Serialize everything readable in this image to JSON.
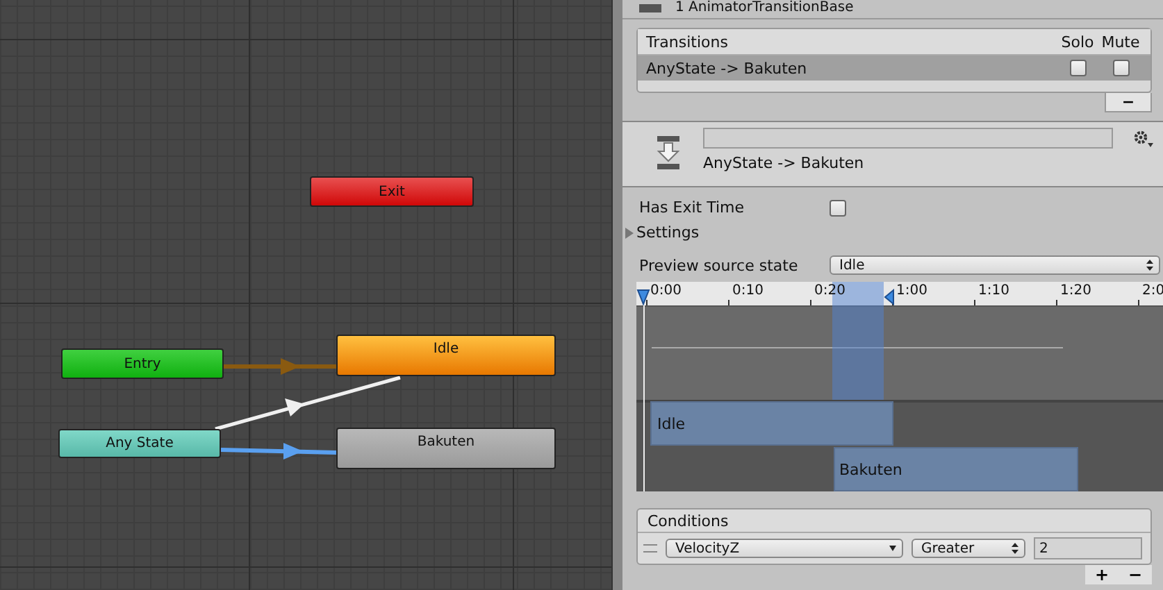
{
  "graph": {
    "nodes": [
      {
        "label": "Exit",
        "kind": "exit"
      },
      {
        "label": "Entry",
        "kind": "entry"
      },
      {
        "label": "Idle",
        "kind": "default"
      },
      {
        "label": "Any State",
        "kind": "any"
      },
      {
        "label": "Bakuten",
        "kind": "state"
      }
    ]
  },
  "inspector": {
    "title": "1 AnimatorTransitionBase",
    "transitions": {
      "heading": "Transitions",
      "solo_heading": "Solo",
      "mute_heading": "Mute",
      "rows": [
        {
          "name": "AnyState -> Bakuten",
          "selected": true,
          "solo": false,
          "mute": false
        }
      ],
      "remove_button": "−"
    },
    "transition": {
      "name": "AnyState -> Bakuten"
    },
    "has_exit_time": {
      "label": "Has Exit Time",
      "checked": false
    },
    "settings": {
      "label": "Settings",
      "expanded": false
    },
    "preview": {
      "label": "Preview source state",
      "value": "Idle"
    },
    "timeline": {
      "ticks": [
        "0:00",
        "0:10",
        "0:20",
        "1:00",
        "1:10",
        "1:20",
        "2:0"
      ],
      "clips": [
        {
          "label": "Idle"
        },
        {
          "label": "Bakuten"
        }
      ]
    },
    "conditions": {
      "heading": "Conditions",
      "rows": [
        {
          "parameter": "VelocityZ",
          "mode": "Greater",
          "value": "2"
        }
      ],
      "add_button": "+",
      "remove_button": "−"
    }
  }
}
